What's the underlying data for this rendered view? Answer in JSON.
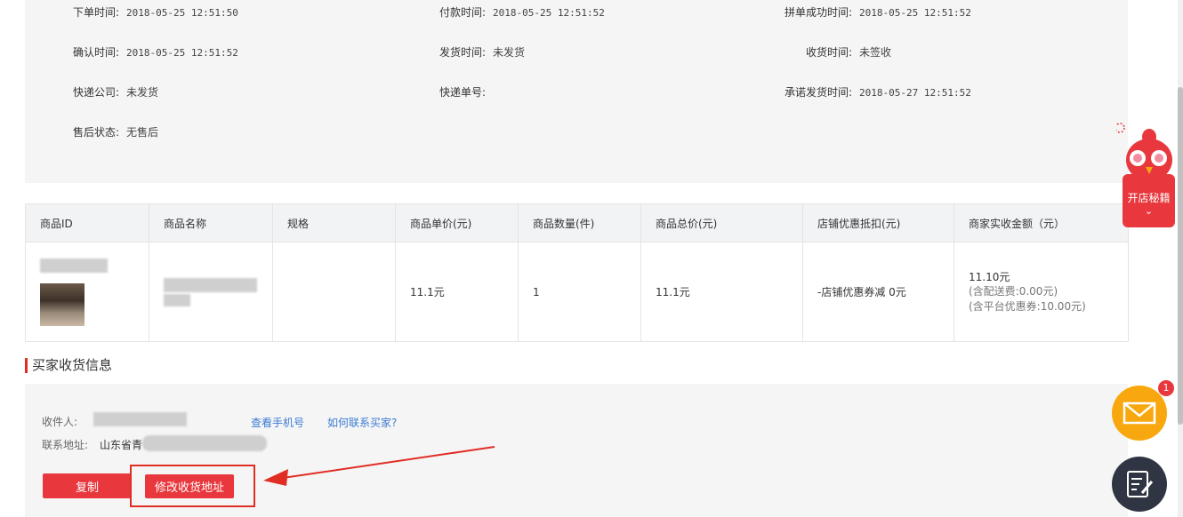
{
  "order_info": {
    "rows": [
      [
        {
          "label": "下单时间:",
          "value": "2018-05-25 12:51:50"
        },
        {
          "label": "付款时间:",
          "value": "2018-05-25 12:51:52"
        },
        {
          "label": "拼单成功时间:",
          "value": "2018-05-25 12:51:52"
        }
      ],
      [
        {
          "label": "确认时间:",
          "value": "2018-05-25 12:51:52"
        },
        {
          "label": "发货时间:",
          "value": "未发货"
        },
        {
          "label": "收货时间:",
          "value": "未签收"
        }
      ],
      [
        {
          "label": "快递公司:",
          "value": "未发货"
        },
        {
          "label": "快递单号:",
          "value": ""
        },
        {
          "label": "承诺发货时间:",
          "value": "2018-05-27 12:51:52"
        }
      ],
      [
        {
          "label": "售后状态:",
          "value": "无售后"
        }
      ]
    ]
  },
  "goods_table": {
    "headers": [
      "商品ID",
      "商品名称",
      "规格",
      "商品单价(元)",
      "商品数量(件)",
      "商品总价(元)",
      "店铺优惠抵扣(元)",
      "商家实收金额（元）"
    ],
    "row": {
      "unit_price": "11.1元",
      "quantity": "1",
      "total_price": "11.1元",
      "shop_discount": "-店铺优惠券减 0元",
      "received_amount": "11.10元",
      "received_shipping": "(含配送费:0.00元)",
      "received_platform": "(含平台优惠券:10.00元)"
    }
  },
  "buyer_section": {
    "title": "买家收货信息",
    "receiver_label": "收件人:",
    "view_phone_link": "查看手机号",
    "contact_buyer_link": "如何联系买家?",
    "address_label": "联系地址:",
    "address_value": "山东省青",
    "copy_button": "复制",
    "modify_address_button": "修改收货地址"
  },
  "floating": {
    "promo_label": "开店秘籍",
    "mail_badge": "1"
  },
  "colors": {
    "accent": "#e8383d",
    "link": "#3b7bd4",
    "mail": "#f8a80e",
    "edit": "#2f3542"
  }
}
